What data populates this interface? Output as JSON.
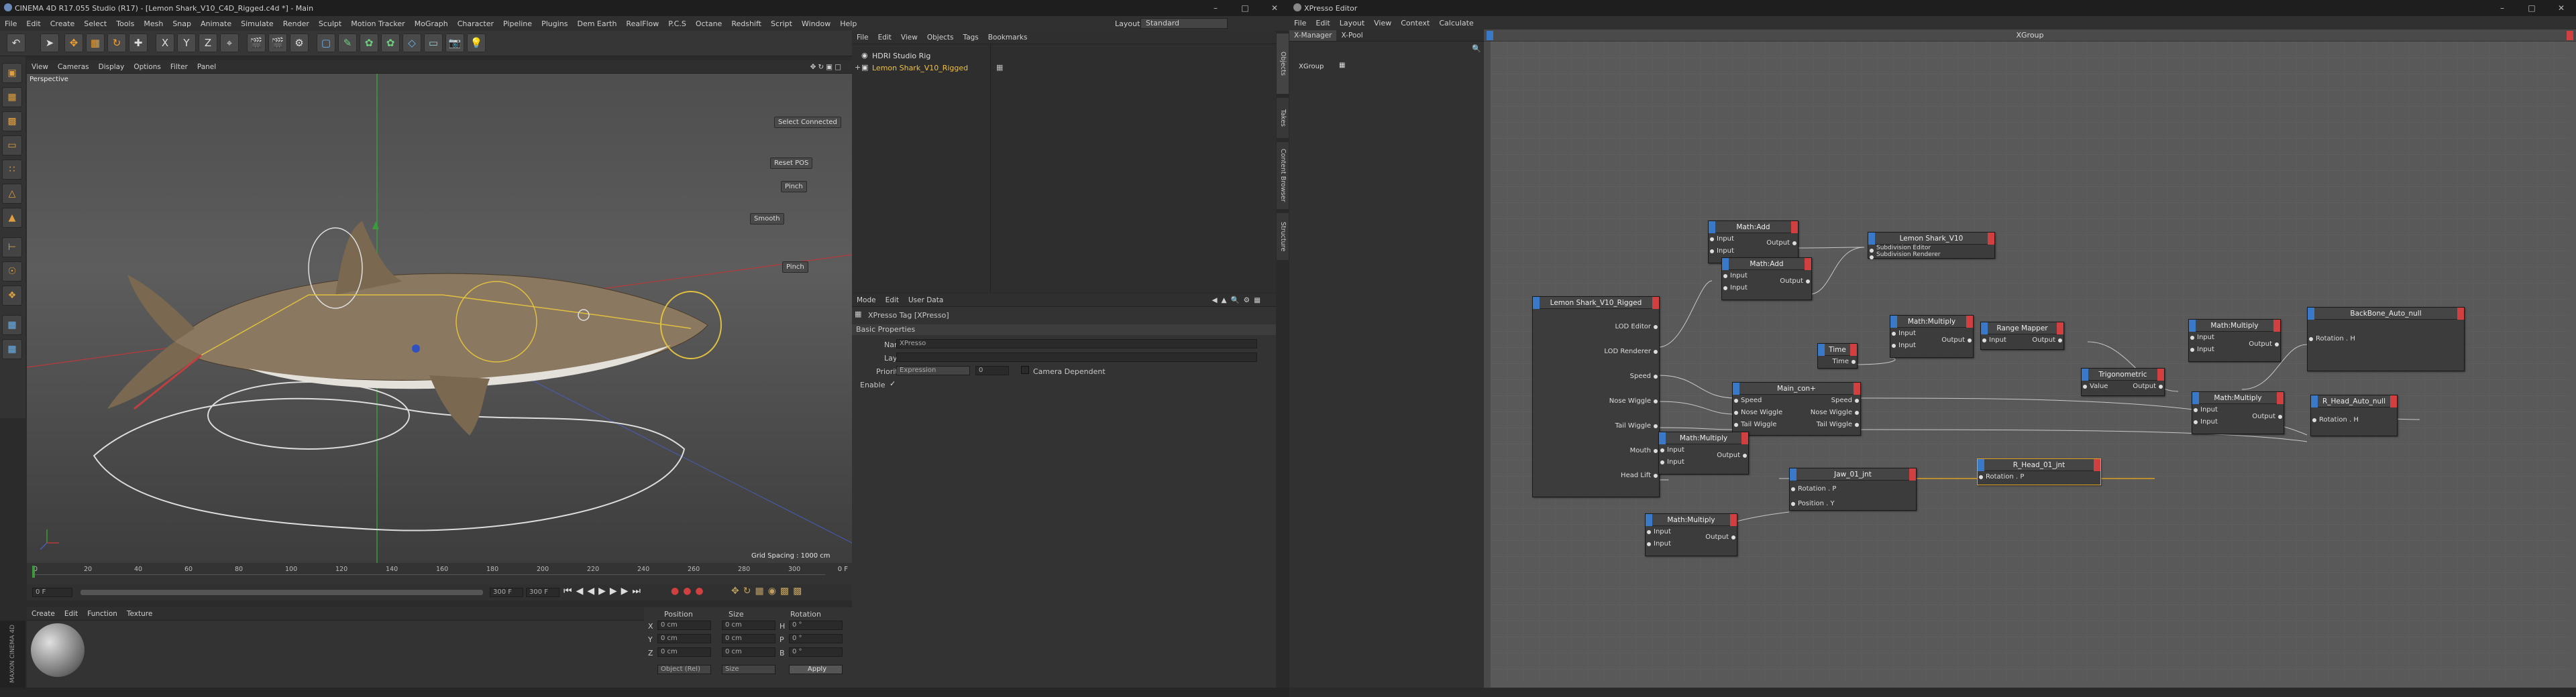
{
  "c4d": {
    "title": "CINEMA 4D R17.055 Studio (R17) - [Lemon Shark_V10_C4D_Rigged.c4d *] - Main",
    "menu": [
      "File",
      "Edit",
      "Create",
      "Select",
      "Tools",
      "Mesh",
      "Snap",
      "Animate",
      "Simulate",
      "Render",
      "Sculpt",
      "Motion Tracker",
      "MoGraph",
      "Character",
      "Pipeline",
      "Plugins",
      "Dem Earth",
      "RealFlow",
      "P.C.S",
      "Octane",
      "Redshift",
      "Script",
      "Window",
      "Help"
    ],
    "layout_label": "Layout:",
    "layout_value": "Standard",
    "viewport_menu": [
      "View",
      "Cameras",
      "Display",
      "Options",
      "Filter",
      "Panel"
    ],
    "viewport_name": "Perspective",
    "vp_buttons": [
      "Select Connected",
      "Reset POS",
      "Pinch",
      "Smooth",
      "Pinch"
    ],
    "grid_spacing": "Grid Spacing : 1000 cm",
    "timeline_ticks": [
      "0",
      "20",
      "40",
      "60",
      "80",
      "100",
      "120",
      "140",
      "160",
      "180",
      "200",
      "220",
      "240",
      "260",
      "280",
      "300"
    ],
    "frame_current": "0 F",
    "frame_start": "0 F",
    "frame_end": "300 F",
    "frame_end2": "300 F",
    "material_menu": [
      "Create",
      "Edit",
      "Function",
      "Texture"
    ],
    "coord_headers": [
      "Position",
      "Size",
      "Rotation"
    ],
    "coords": [
      {
        "axis": "X",
        "pos": "0 cm",
        "size": "0 cm",
        "rotlabel": "H",
        "rot": "0 °"
      },
      {
        "axis": "Y",
        "pos": "0 cm",
        "size": "0 cm",
        "rotlabel": "P",
        "rot": "0 °"
      },
      {
        "axis": "Z",
        "pos": "0 cm",
        "size": "0 cm",
        "rotlabel": "B",
        "rot": "0 °"
      }
    ],
    "coord_mode": "Object (Rel)",
    "coord_size_mode": "Size",
    "apply_label": "Apply",
    "maxon_label": "MAXON CINEMA 4D",
    "objects_menu": [
      "File",
      "Edit",
      "View",
      "Objects",
      "Tags",
      "Bookmarks"
    ],
    "objects": [
      "HDRI Studio Rig",
      "Lemon Shark_V10_Rigged"
    ],
    "attr_menu": [
      "Mode",
      "Edit",
      "User Data"
    ],
    "attr_title": "XPresso Tag [XPresso]",
    "attr_section": "Basic Properties",
    "attr_fields": {
      "name_label": "Name",
      "name_value": "XPresso",
      "layer_label": "Layer",
      "priority_label": "Priority",
      "priority_value": "Expression",
      "priority_num": "0",
      "camera_dep": "Camera Dependent",
      "enable_label": "Enable"
    },
    "side_tabs_right": [
      "Objects",
      "Takes",
      "Content Browser",
      "Structure"
    ]
  },
  "xpresso": {
    "title": "XPresso Editor",
    "menu": [
      "File",
      "Edit",
      "Layout",
      "View",
      "Context",
      "Calculate"
    ],
    "tabs": [
      "X-Manager",
      "X-Pool"
    ],
    "tree_root": "XGroup",
    "group_title": "XGroup",
    "nodes": {
      "shark": {
        "title": "Lemon Shark_V10_Rigged",
        "ports": [
          "LOD Editor",
          "LOD Renderer",
          "Speed",
          "Nose Wiggle",
          "Tail Wiggle",
          "Mouth",
          "Head Lift"
        ]
      },
      "add1": {
        "title": "Math:Add",
        "in": [
          "Input",
          "Input"
        ],
        "out": "Output"
      },
      "add2": {
        "title": "Math:Add",
        "in": [
          "Input",
          "Input"
        ],
        "out": "Output"
      },
      "shark_v10": {
        "title": "Lemon Shark_V10",
        "ports": [
          "Subdivision Editor",
          "Subdivision Renderer"
        ]
      },
      "time": {
        "title": "Time",
        "out": "Time"
      },
      "mult1": {
        "title": "Math:Multiply",
        "in": [
          "Input",
          "Input"
        ],
        "out": "Output"
      },
      "range": {
        "title": "Range Mapper",
        "in": "Input",
        "out": "Output"
      },
      "trig": {
        "title": "Trigonometric",
        "in": "Value",
        "out": "Output"
      },
      "mult2": {
        "title": "Math:Multiply",
        "in": [
          "Input",
          "Input"
        ],
        "out": "Output"
      },
      "mult3": {
        "title": "Math:Multiply",
        "in": [
          "Input",
          "Input"
        ],
        "out": "Output"
      },
      "backbone": {
        "title": "BackBone_Auto_null",
        "in": "Rotation . H"
      },
      "rhead": {
        "title": "R_Head_Auto_null",
        "in": "Rotation . H"
      },
      "main": {
        "title": "Main_con+",
        "in": [
          "Speed",
          "Nose Wiggle",
          "Tail Wiggle"
        ],
        "out": [
          "Speed",
          "Nose Wiggle",
          "Tail Wiggle"
        ]
      },
      "mult4": {
        "title": "Math:Multiply",
        "in": [
          "Input",
          "Input"
        ],
        "out": "Output"
      },
      "jaw": {
        "title": "Jaw_01_jnt",
        "in": [
          "Rotation . P",
          "Position . Y"
        ]
      },
      "rhead01": {
        "title": "R_Head_01_jnt",
        "in": "Rotation . P"
      },
      "mult5": {
        "title": "Math:Multiply",
        "in": [
          "Input",
          "Input"
        ],
        "out": "Output"
      }
    }
  }
}
